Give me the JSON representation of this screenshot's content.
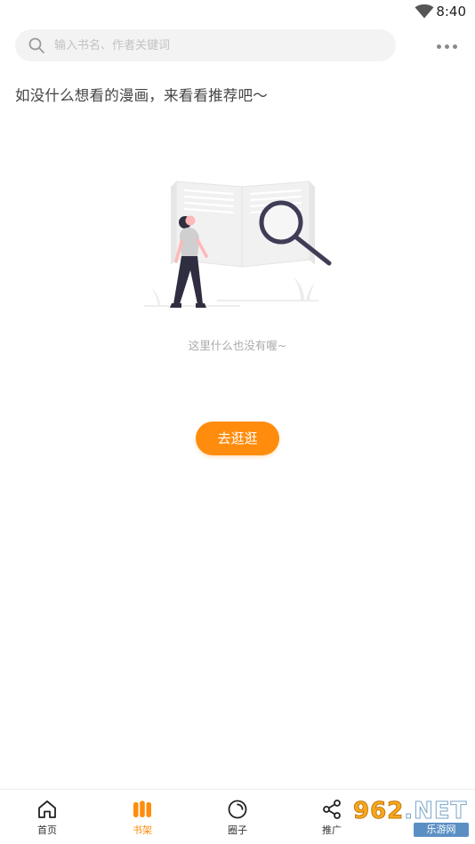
{
  "status_bar": {
    "time": "8:40",
    "wifi_icon": "wifi-icon"
  },
  "search": {
    "placeholder": "输入书名、作者关键词",
    "value": "",
    "icon": "search-icon"
  },
  "more_menu": {
    "icon": "more-horizontal-icon"
  },
  "prompt": "如没什么想看的漫画，来看看推荐吧～",
  "empty_state": {
    "illustration": "empty-search-illustration",
    "message": "这里什么也没有喔~"
  },
  "go_button_label": "去逛逛",
  "bottom_nav": {
    "items": [
      {
        "label": "首页",
        "icon": "home-icon",
        "active": false
      },
      {
        "label": "书架",
        "icon": "bookshelf-icon",
        "active": true
      },
      {
        "label": "圈子",
        "icon": "circle-icon",
        "active": false
      },
      {
        "label": "推广",
        "icon": "share-icon",
        "active": false
      }
    ]
  },
  "watermark": {
    "main_digits": "962",
    "main_suffix": ".NET",
    "sub": "乐游网"
  },
  "colors": {
    "accent": "#ff8c0d",
    "text": "#444444",
    "muted": "#aaaaaa",
    "search_bg": "#f3f3f3"
  }
}
